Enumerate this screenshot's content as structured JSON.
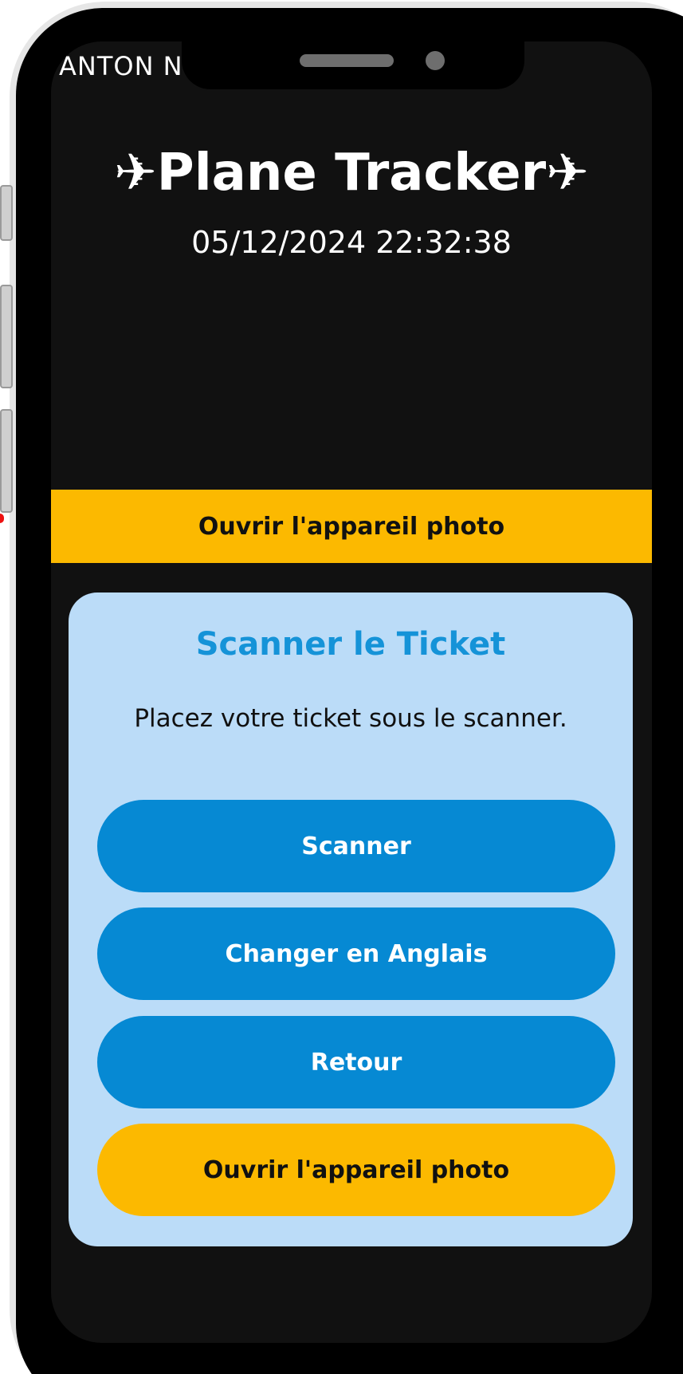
{
  "status_bar": {
    "carrier_text": "ANTON N"
  },
  "header": {
    "title": "✈Plane Tracker✈",
    "datetime": "05/12/2024 22:32:38"
  },
  "camera_bar": {
    "label": "Ouvrir l'appareil photo"
  },
  "scan_card": {
    "title": "Scanner le Ticket",
    "instruction": "Placez votre ticket sous le scanner.",
    "buttons": [
      {
        "label": "Scanner"
      },
      {
        "label": "Changer en Anglais"
      },
      {
        "label": "Retour"
      },
      {
        "label": "Ouvrir l'appareil photo"
      }
    ]
  },
  "colors": {
    "accent_yellow": "#fcb900",
    "button_blue": "#0689d3",
    "card_background": "#bbdcf8",
    "card_title": "#1593d8",
    "screen_background": "#111111"
  }
}
